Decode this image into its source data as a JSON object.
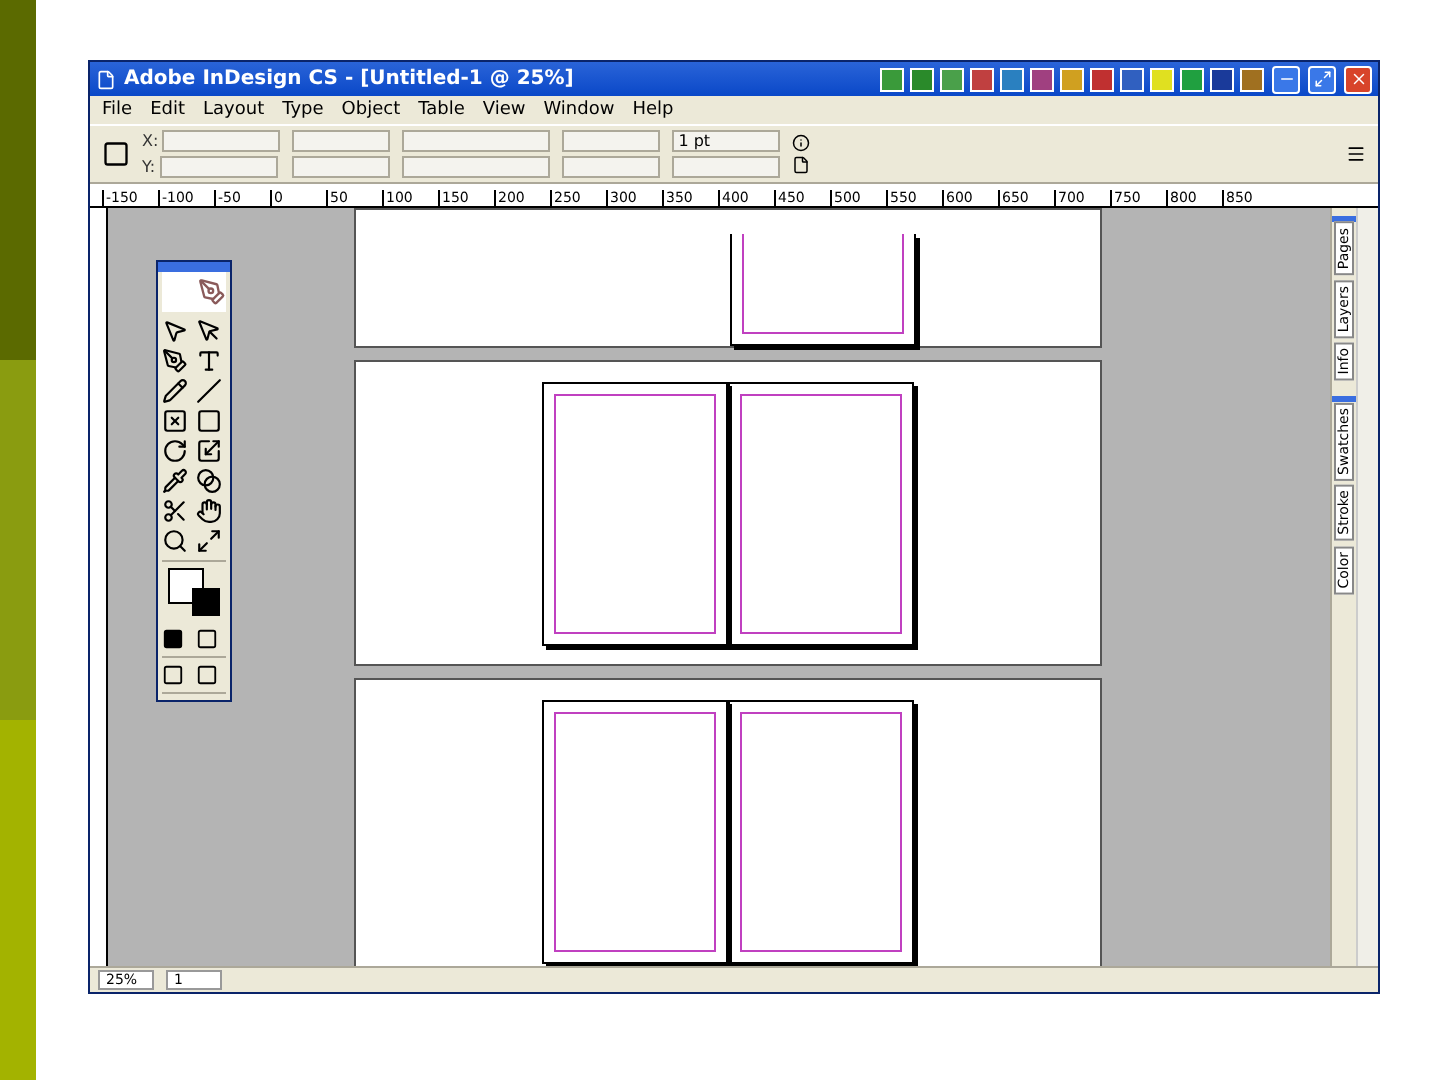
{
  "window": {
    "title": "Adobe InDesign CS - [Untitled-1 @ 25%]"
  },
  "menu": [
    "File",
    "Edit",
    "Layout",
    "Type",
    "Object",
    "Table",
    "View",
    "Window",
    "Help"
  ],
  "control_panel": {
    "fields": [
      {
        "label": "X:"
      },
      {
        "label": "Y:"
      }
    ],
    "stroke_weight": "1 pt"
  },
  "ruler": [
    "-150",
    "-100",
    "-50",
    "0",
    "50",
    "100",
    "150",
    "200",
    "250",
    "300",
    "350",
    "400",
    "450",
    "500",
    "550",
    "600",
    "650",
    "700",
    "750",
    "800",
    "850"
  ],
  "spreads": [
    {
      "kind": "partial"
    },
    {
      "kind": "pair"
    },
    {
      "kind": "pair"
    }
  ],
  "side_panels": [
    {
      "tabs": [
        "Pages",
        "Layers",
        "Info"
      ]
    },
    {
      "tabs": [
        "Swatches",
        "Stroke",
        "Color"
      ]
    }
  ],
  "status_bar": {
    "zoom": "25%",
    "page": "1"
  }
}
